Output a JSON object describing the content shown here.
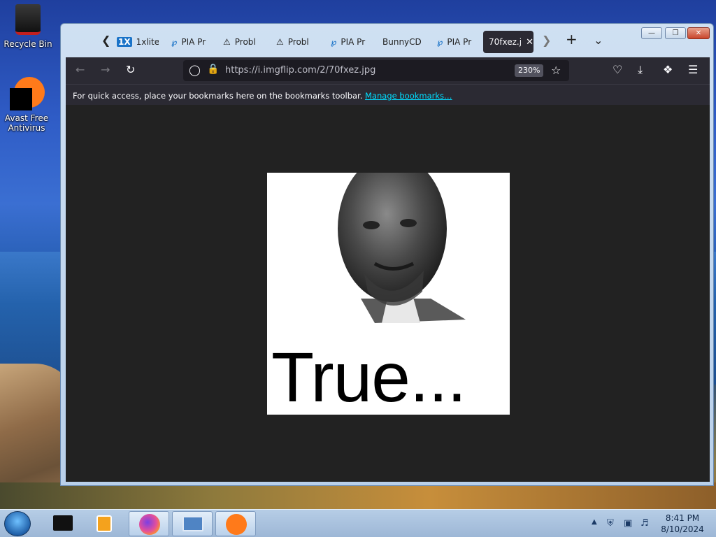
{
  "desktop": {
    "icons": [
      {
        "label": "Recycle Bin"
      },
      {
        "label": "Avast Free Antivirus"
      }
    ]
  },
  "browser": {
    "tabs": [
      {
        "title": "1xlite-",
        "icon": "1x-logo-icon"
      },
      {
        "title": "PIA Pr",
        "icon": "pia-icon"
      },
      {
        "title": "Probl",
        "icon": "warning-icon"
      },
      {
        "title": "Probl",
        "icon": "warning-icon"
      },
      {
        "title": "PIA Pr",
        "icon": "pia-icon"
      },
      {
        "title": "BunnyCD",
        "icon": ""
      },
      {
        "title": "PIA Pr",
        "icon": "pia-icon"
      },
      {
        "title": "70fxez.j",
        "icon": "",
        "active": true
      }
    ],
    "url": "https://i.imgflip.com/2/70fxez.jpg",
    "zoom": "230%",
    "bookmarks_prompt": "For quick access, place your bookmarks here on the bookmarks toolbar.",
    "manage_bookmarks": "Manage bookmarks…"
  },
  "meme": {
    "caption": "True..."
  },
  "taskbar": {
    "time": "8:41 PM",
    "date": "8/10/2024"
  },
  "colors": {
    "browser_chrome": "#2b2a33",
    "content_bg": "#222222",
    "link": "#00ddff"
  }
}
